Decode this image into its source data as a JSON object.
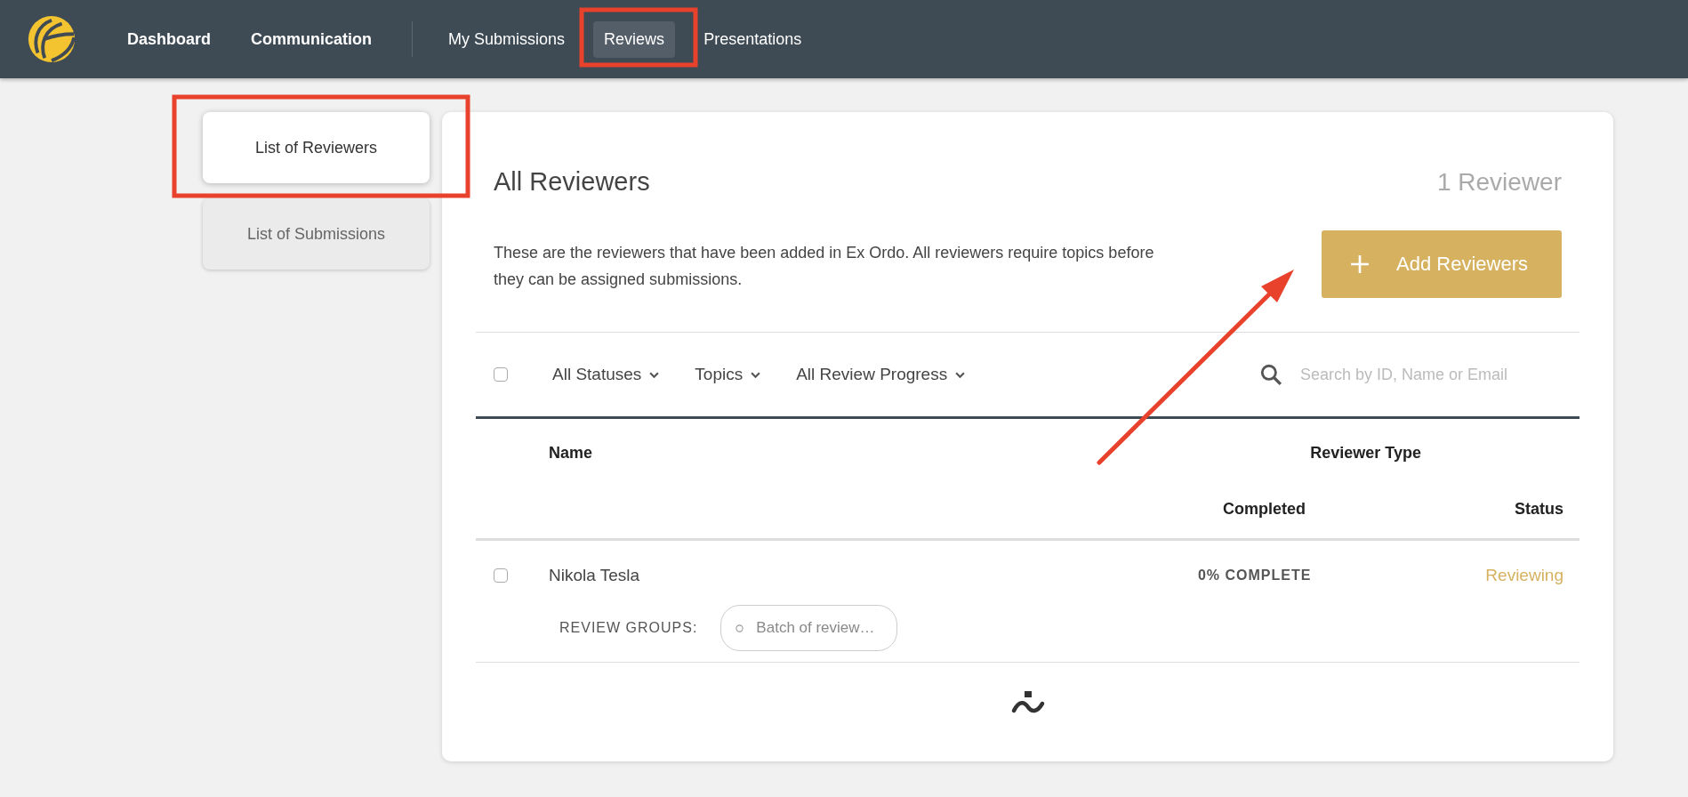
{
  "nav": {
    "primary": [
      {
        "label": "Dashboard"
      },
      {
        "label": "Communication"
      }
    ],
    "secondary": [
      {
        "label": "My Submissions",
        "selected": false
      },
      {
        "label": "Reviews",
        "selected": true
      },
      {
        "label": "Presentations",
        "selected": false
      }
    ]
  },
  "sidebar": {
    "tabs": [
      {
        "label": "List of Reviewers",
        "selected": true
      },
      {
        "label": "List of Submissions",
        "selected": false
      }
    ]
  },
  "panel": {
    "title": "All Reviewers",
    "count": "1 Reviewer",
    "description": "These are the reviewers that have been added in Ex Ordo. All reviewers require topics before they can be assigned submissions.",
    "add_button": "Add Reviewers"
  },
  "filters": {
    "select_all": {
      "checked": false
    },
    "dropdowns": [
      "All Statuses",
      "Topics",
      "All Review Progress"
    ],
    "search": {
      "placeholder": "Search by ID, Name or Email"
    }
  },
  "table": {
    "columns": {
      "name": "Name",
      "reviewer_type": "Reviewer Type",
      "completed": "Completed",
      "status": "Status"
    },
    "rows": [
      {
        "checked": false,
        "name": "Nikola Tesla",
        "completed": "0% COMPLETE",
        "status": "Reviewing",
        "review_groups_label": "REVIEW GROUPS:",
        "review_groups": [
          "Batch of review…"
        ]
      }
    ]
  }
}
